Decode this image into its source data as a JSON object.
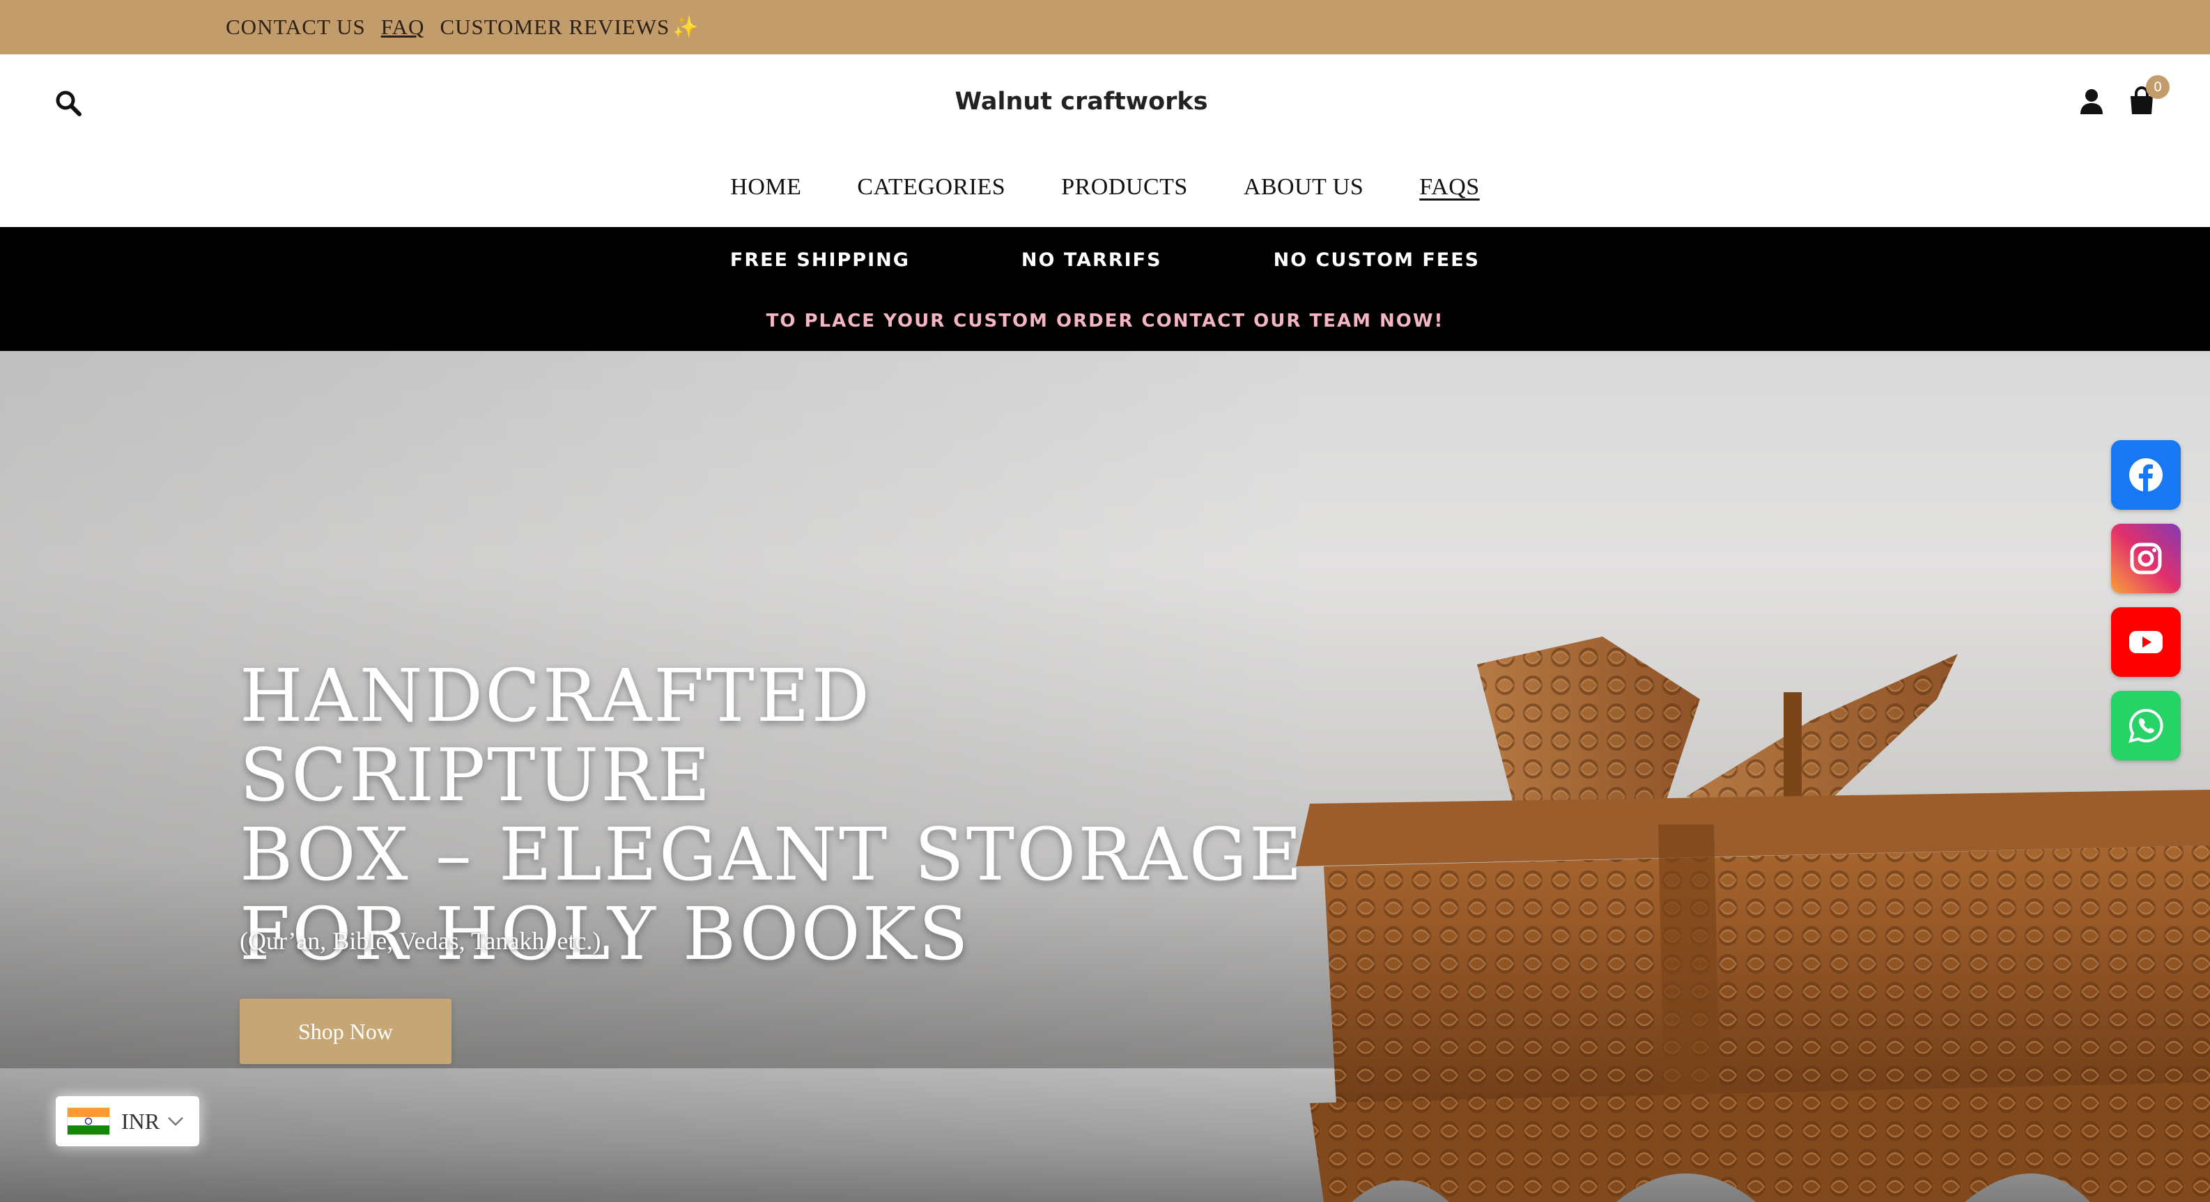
{
  "topbar": {
    "links": [
      "CONTACT US",
      "FAQ",
      "CUSTOMER REVIEWS"
    ],
    "sparkle": "✨"
  },
  "header": {
    "brand": "Walnut craftworks",
    "cart_count": "0",
    "nav": [
      "HOME",
      "CATEGORIES",
      "PRODUCTS",
      "ABOUT US",
      "FAQS"
    ]
  },
  "promo": {
    "items": [
      "FREE SHIPPING",
      "NO TARRIFS",
      "NO CUSTOM FEES"
    ],
    "notice": "TO PLACE YOUR CUSTOM ORDER CONTACT OUR TEAM NOW!"
  },
  "hero": {
    "title_lines": [
      "HANDCRAFTED SCRIPTURE",
      "BOX – ELEGANT STORAGE",
      "FOR HOLY BOOKS"
    ],
    "subtitle": "(Qur’an, Bible, Vedas, Tanakh, etc.)",
    "cta": "Shop Now"
  },
  "social": [
    "facebook-icon",
    "instagram-icon",
    "youtube-icon",
    "whatsapp-icon"
  ],
  "currency": {
    "code": "INR",
    "flag": "india-flag-icon"
  },
  "colors": {
    "topbar": "#c29c6a",
    "cta": "#c7a675",
    "promo_bg": "#000000",
    "promo_notice": "#f4b6c2"
  }
}
